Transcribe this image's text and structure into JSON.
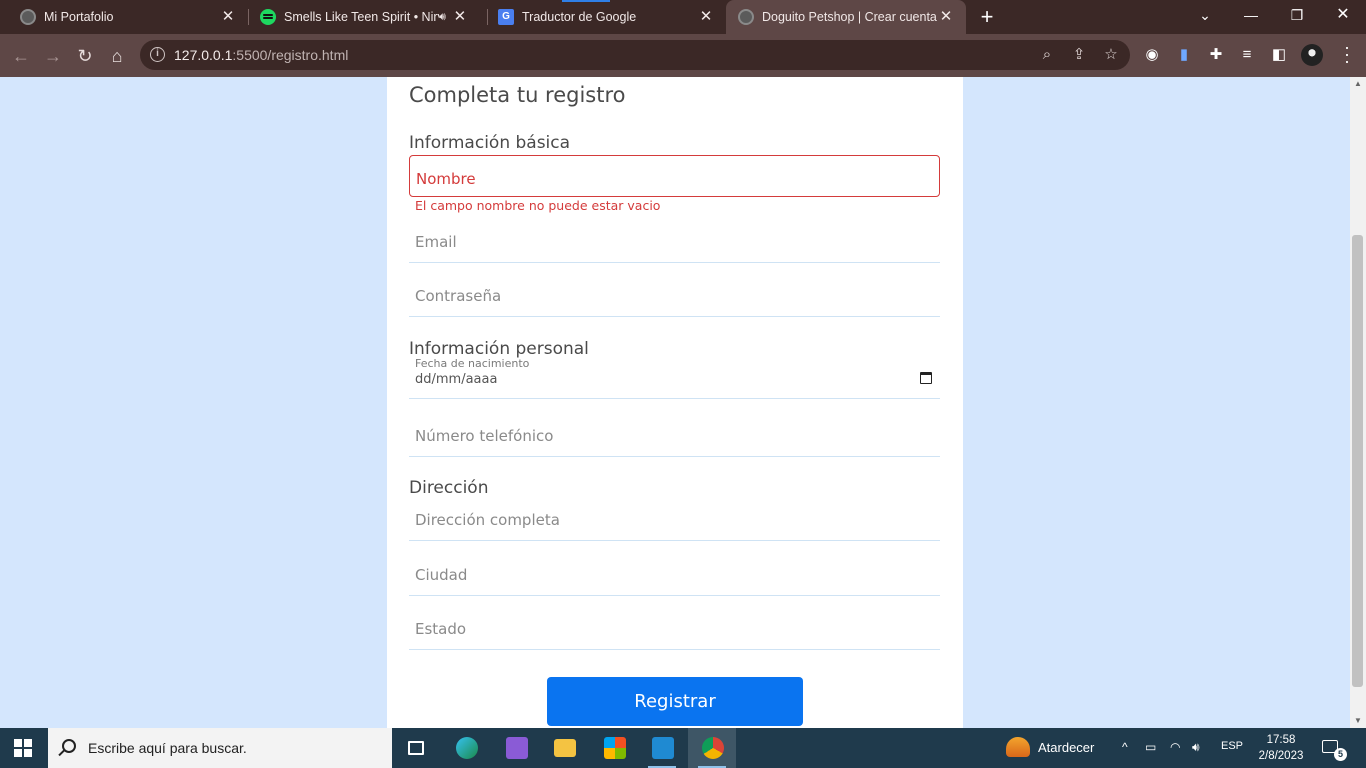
{
  "browser": {
    "tabs": [
      {
        "title": "Mi Portafolio",
        "favicon": "globe-icon",
        "active": false
      },
      {
        "title": "Smells Like Teen Spirit • Nirvana",
        "favicon": "spotify-icon",
        "active": false,
        "playing_audio": true
      },
      {
        "title": "Traductor de Google",
        "favicon": "google-translate-icon",
        "active": false
      },
      {
        "title": "Doguito Petshop | Crear cuenta",
        "favicon": "globe-icon",
        "active": true
      }
    ],
    "url_host": "127.0.0.1",
    "url_path": ":5500/registro.html"
  },
  "form": {
    "title": "Completa tu registro",
    "section_basic": "Información básica",
    "name_placeholder": "Nombre",
    "name_error": "El campo nombre no puede estar vacio",
    "email_placeholder": "Email",
    "password_placeholder": "Contraseña",
    "section_personal": "Información personal",
    "birth_label": "Fecha de nacimiento",
    "birth_placeholder": "dd/mm/aaaa",
    "phone_placeholder": "Número telefónico",
    "section_address": "Dirección",
    "address_placeholder": "Dirección completa",
    "city_placeholder": "Ciudad",
    "state_placeholder": "Estado",
    "submit_label": "Registrar"
  },
  "colors": {
    "page_bg": "#d4e6fd",
    "error": "#d43b3b",
    "button": "#0a74f0",
    "tabstrip": "#3b2826",
    "toolbar": "#5e4746",
    "taskbar": "#1f3a4c"
  },
  "taskbar": {
    "search_placeholder": "Escribe aquí para buscar.",
    "weather": "Atardecer",
    "language": "ESP",
    "time": "17:58",
    "date": "2/8/2023",
    "notifications": "5",
    "apps": [
      "task-view-icon",
      "edge-icon",
      "visual-studio-icon",
      "file-explorer-icon",
      "microsoft-store-icon",
      "vscode-icon",
      "chrome-icon"
    ]
  }
}
